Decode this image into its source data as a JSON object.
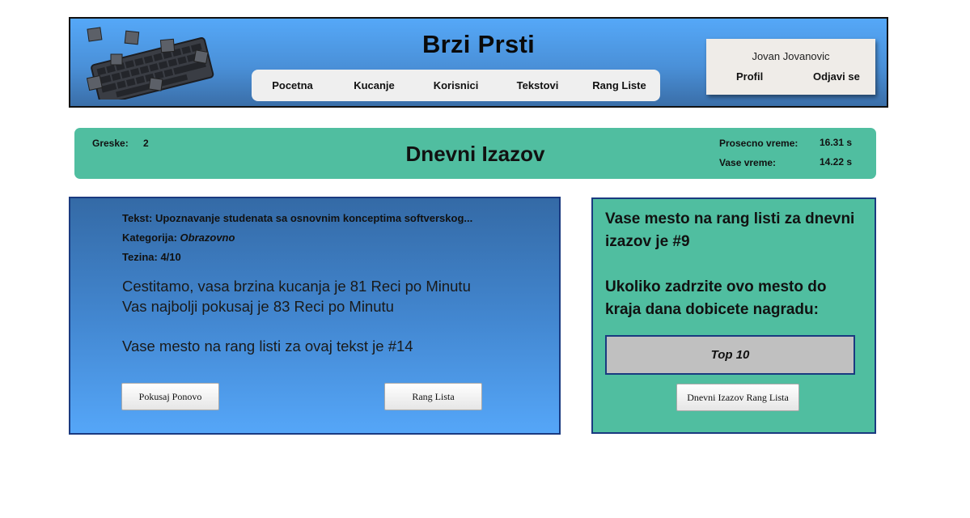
{
  "header": {
    "site_title": "Brzi Prsti",
    "logo_icon": "keyboard-icon",
    "nav": [
      "Pocetna",
      "Kucanje",
      "Korisnici",
      "Tekstovi",
      "Rang Liste"
    ],
    "user": {
      "name": "Jovan Jovanovic",
      "profile_label": "Profil",
      "logout_label": "Odjavi se"
    }
  },
  "challenge": {
    "title": "Dnevni Izazov",
    "errors_label": "Greske:",
    "errors_value": "2",
    "avg_time_label": "Prosecno vreme:",
    "avg_time_value": "16.31 s",
    "your_time_label": "Vase vreme:",
    "your_time_value": "14.22 s"
  },
  "result": {
    "text_label": "Tekst:",
    "text_value": "Upoznavanje studenata sa osnovnim konceptima softverskog...",
    "category_label": "Kategorija:",
    "category_value": "Obrazovno",
    "difficulty_label": "Tezina:",
    "difficulty_value": "4/10",
    "speed_line": "Cestitamo, vasa brzina kucanja je 81 Reci po Minutu",
    "best_line": "Vas najbolji pokusaj je 83 Reci po Minutu",
    "rank_line": "Vase mesto na rang listi za ovaj tekst je #14",
    "retry_button": "Pokusaj Ponovo",
    "leaderboard_button": "Rang Lista"
  },
  "daily": {
    "rank_text": "Vase mesto na rang listi za dnevni izazov je #9",
    "reward_text": "Ukoliko zadrzite ovo mesto do kraja dana dobicete nagradu:",
    "reward_tier": "Top 10",
    "leaderboard_button": "Dnevni Izazov Rang Lista"
  },
  "colors": {
    "header_gradient_top": "#55a8f8",
    "header_gradient_bottom": "#3a6ea8",
    "teal": "#50bea0",
    "panel_border": "#1a3a80",
    "reward_box": "#c0c0c0"
  }
}
